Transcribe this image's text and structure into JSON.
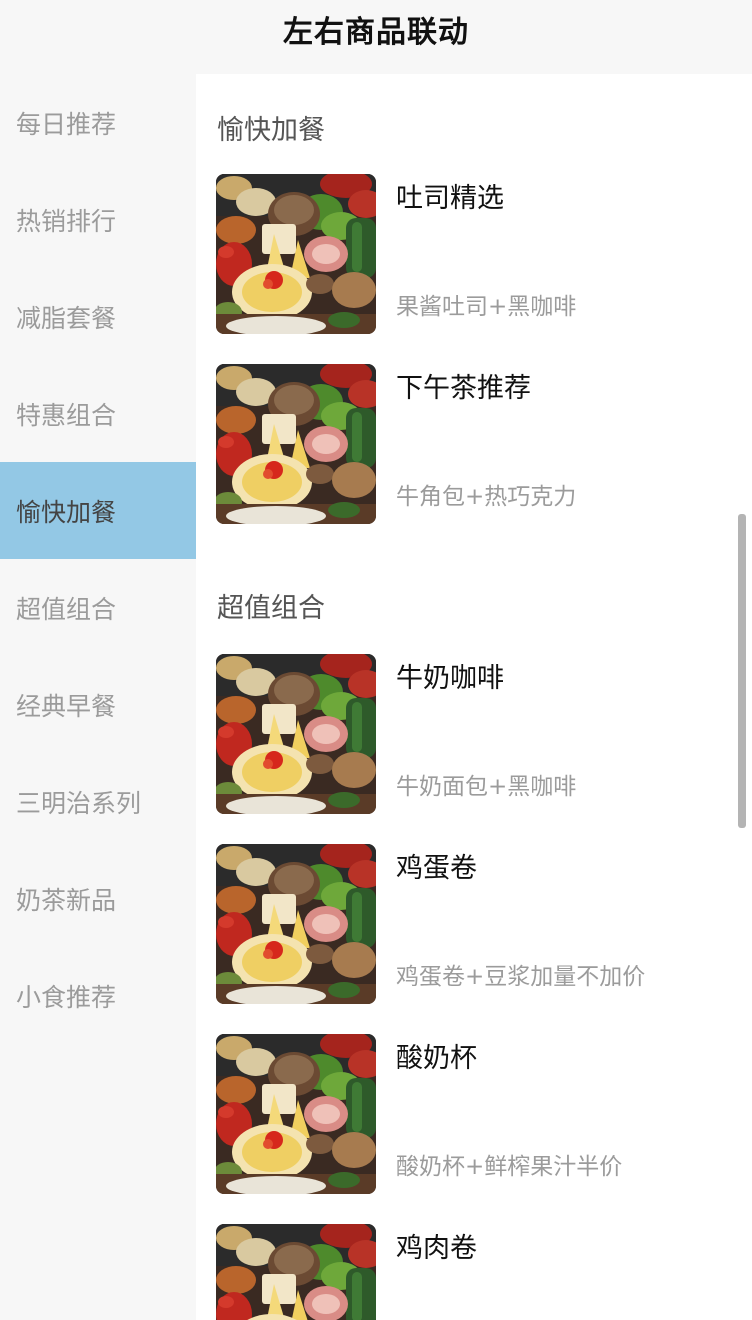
{
  "header": {
    "title": "左右商品联动"
  },
  "sidebar": {
    "active_index": 4,
    "accent_color": "#93c8e5",
    "items": [
      {
        "label": "每日推荐"
      },
      {
        "label": "热销排行"
      },
      {
        "label": "减脂套餐"
      },
      {
        "label": "特惠组合"
      },
      {
        "label": "愉快加餐"
      },
      {
        "label": "超值组合"
      },
      {
        "label": "经典早餐"
      },
      {
        "label": "三明治系列"
      },
      {
        "label": "奶茶新品"
      },
      {
        "label": "小食推荐"
      }
    ]
  },
  "content": {
    "sections": [
      {
        "title": "愉快加餐",
        "products": [
          {
            "name": "吐司精选",
            "desc": "果酱吐司+黑咖啡",
            "image": "food-platter-photo"
          },
          {
            "name": "下午茶推荐",
            "desc": "牛角包+热巧克力",
            "image": "food-platter-photo"
          }
        ]
      },
      {
        "title": "超值组合",
        "products": [
          {
            "name": "牛奶咖啡",
            "desc": "牛奶面包+黑咖啡",
            "image": "food-platter-photo"
          },
          {
            "name": "鸡蛋卷",
            "desc": "鸡蛋卷+豆浆加量不加价",
            "image": "food-platter-photo"
          },
          {
            "name": "酸奶杯",
            "desc": "酸奶杯+鲜榨果汁半价",
            "image": "food-platter-photo"
          },
          {
            "name": "鸡肉卷",
            "desc": "",
            "image": "food-platter-photo"
          }
        ]
      }
    ]
  }
}
